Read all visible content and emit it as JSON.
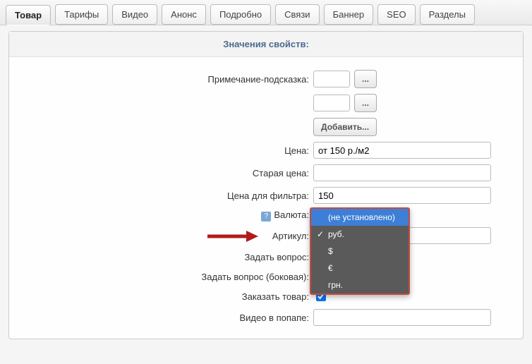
{
  "tabs": [
    {
      "label": "Товар",
      "active": true
    },
    {
      "label": "Тарифы"
    },
    {
      "label": "Видео"
    },
    {
      "label": "Анонс"
    },
    {
      "label": "Подробно"
    },
    {
      "label": "Связи"
    },
    {
      "label": "Баннер"
    },
    {
      "label": "SEO"
    },
    {
      "label": "Разделы"
    }
  ],
  "section_header": "Значения свойств:",
  "labels": {
    "hint": "Примечание-подсказка:",
    "price": "Цена:",
    "old_price": "Старая цена:",
    "filter_price": "Цена для фильтра:",
    "currency": "Валюта:",
    "sku": "Артикул:",
    "ask_question": "Задать вопрос:",
    "ask_question_side": "Задать вопрос (боковая):",
    "order": "Заказать товар:",
    "video_popup": "Видео в попапе:"
  },
  "values": {
    "price": "от 150 р./м2",
    "old_price": "",
    "filter_price": "150",
    "sku": "",
    "video_popup": "",
    "ask_question": false,
    "ask_question_side": false,
    "order": true
  },
  "buttons": {
    "ellipsis": "...",
    "add": "Добавить..."
  },
  "help_icon": "?",
  "currency_dropdown": {
    "items": [
      {
        "label": "(не установлено)",
        "highlight": true,
        "checked": false
      },
      {
        "label": "руб.",
        "checked": true
      },
      {
        "label": "$",
        "checked": false
      },
      {
        "label": "€",
        "checked": false
      },
      {
        "label": "грн.",
        "checked": false
      }
    ]
  }
}
